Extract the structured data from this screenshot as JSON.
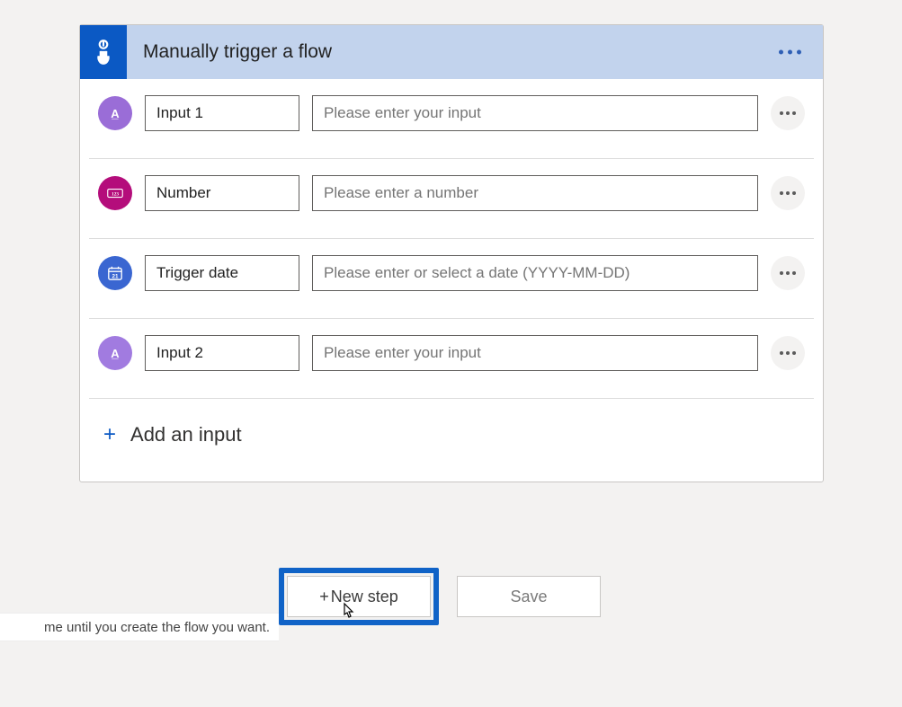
{
  "header": {
    "title": "Manually trigger a flow"
  },
  "inputs": [
    {
      "icon": "text",
      "name": "Input 1",
      "desc": "Please enter your input"
    },
    {
      "icon": "number",
      "name": "Number",
      "desc": "Please enter a number"
    },
    {
      "icon": "date",
      "name": "Trigger date",
      "desc": "Please enter or select a date (YYYY-MM-DD)"
    },
    {
      "icon": "text2",
      "name": "Input 2",
      "desc": "Please enter your input"
    }
  ],
  "add_input_label": "Add an input",
  "buttons": {
    "new_step": "New step",
    "save": "Save"
  },
  "hint_partial": "me until you create the flow you want."
}
